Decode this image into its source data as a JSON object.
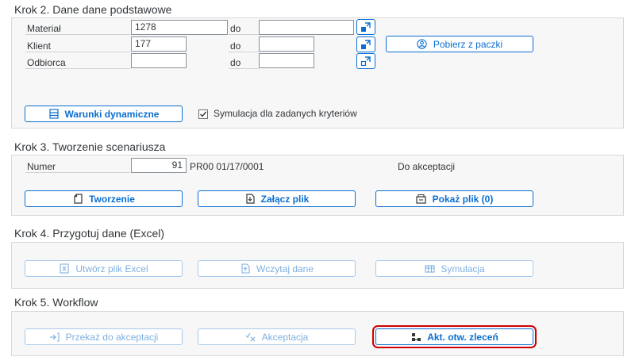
{
  "step2": {
    "title": "Krok 2. Dane dane podstawowe",
    "rows": [
      {
        "label": "Materiał",
        "from": "1278",
        "to_label": "do",
        "to": ""
      },
      {
        "label": "Klient",
        "from": "177",
        "to_label": "do",
        "to": ""
      },
      {
        "label": "Odbiorca",
        "from": "",
        "to_label": "do",
        "to": ""
      }
    ],
    "fetch_button": "Pobierz z paczki",
    "dynamic_button": "Warunki dynamiczne",
    "simulation_checkbox": {
      "label": "Symulacja dla zadanych kryteriów",
      "checked": true
    }
  },
  "step3": {
    "title": "Krok 3. Tworzenie scenariusza",
    "number_label": "Numer",
    "number_value": "91",
    "number_code": "PR00 01/17/0001",
    "status": "Do akceptacji",
    "buttons": {
      "create": "Tworzenie",
      "attach": "Załącz plik",
      "show": "Pokaż plik (0)"
    }
  },
  "step4": {
    "title": "Krok 4. Przygotuj dane (Excel)",
    "buttons": {
      "create_excel": "Utwórz plik Excel",
      "load": "Wczytaj dane",
      "simulate": "Symulacja"
    }
  },
  "step5": {
    "title": "Krok 5. Workflow",
    "buttons": {
      "send": "Przekaż do akceptacji",
      "accept": "Akceptacja",
      "update": "Akt. otw. zleceń"
    }
  },
  "colors": {
    "accent": "#0a6ed1",
    "focus": "#d00000",
    "panel_bg": "#f7f7f7"
  }
}
